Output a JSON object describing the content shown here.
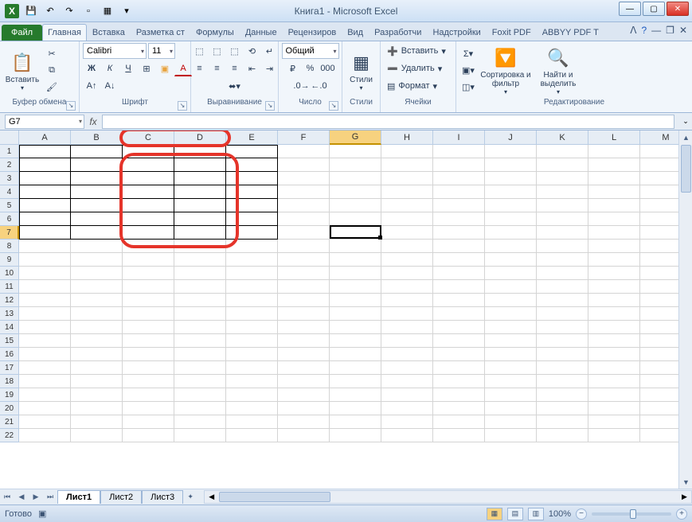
{
  "window": {
    "title": "Книга1  -  Microsoft Excel"
  },
  "qat": {
    "save": "💾",
    "undo": "↶",
    "redo": "↷",
    "new": "▫",
    "print": "▦",
    "more": "▾"
  },
  "tabs": {
    "file": "Файл",
    "items": [
      "Главная",
      "Вставка",
      "Разметка ст",
      "Формулы",
      "Данные",
      "Рецензиров",
      "Вид",
      "Разработчи",
      "Надстройки",
      "Foxit PDF",
      "ABBYY PDF T"
    ],
    "active_index": 0
  },
  "ribbon": {
    "clipboard": {
      "paste": "Вставить",
      "label": "Буфер обмена"
    },
    "font": {
      "name": "Calibri",
      "size": "11",
      "bold": "Ж",
      "italic": "К",
      "underline": "Ч",
      "border": "⊞",
      "fill": "▣",
      "color": "A",
      "grow": "A",
      "shrink": "ᴀ",
      "label": "Шрифт"
    },
    "align": {
      "label": "Выравнивание"
    },
    "number": {
      "format": "Общий",
      "label": "Число"
    },
    "styles": {
      "btn": "Стили",
      "label": "Стили"
    },
    "cells": {
      "insert": "Вставить",
      "delete": "Удалить",
      "format": "Формат",
      "label": "Ячейки"
    },
    "editing": {
      "sort": "Сортировка и фильтр",
      "find": "Найти и выделить",
      "label": "Редактирование"
    }
  },
  "namebox": "G7",
  "fx_label": "fx",
  "columns": [
    "A",
    "B",
    "C",
    "D",
    "E",
    "F",
    "G",
    "H",
    "I",
    "J",
    "K",
    "L",
    "M"
  ],
  "row_count": 22,
  "selected_col_index": 6,
  "selected_row_index": 6,
  "bordered_region": {
    "r0": 0,
    "r1": 6,
    "c0": 0,
    "c1": 4
  },
  "sheets": {
    "items": [
      "Лист1",
      "Лист2",
      "Лист3"
    ],
    "active_index": 0
  },
  "status": {
    "ready": "Готово",
    "zoom": "100%"
  }
}
